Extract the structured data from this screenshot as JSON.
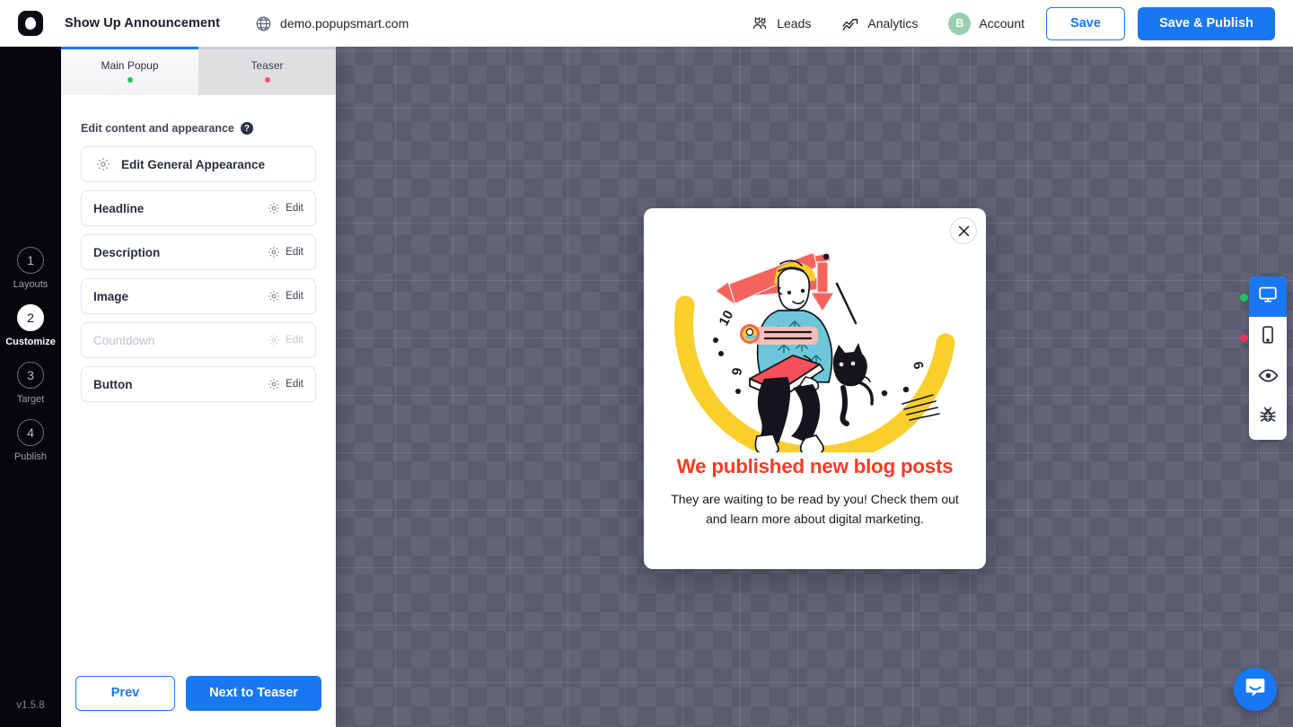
{
  "topbar": {
    "logo_icon": "popupsmart-logo-icon",
    "project_title": "Show Up Announcement",
    "site": {
      "globe_icon": "globe-icon",
      "url": "demo.popupsmart.com"
    },
    "links": [
      {
        "icon": "leads-people-icon",
        "label": "Leads"
      },
      {
        "icon": "analytics-chart-icon",
        "label": "Analytics"
      }
    ],
    "account": {
      "avatar_initial": "B",
      "avatar_color": "#97cfb0",
      "label": "Account"
    },
    "save_label": "Save",
    "publish_label": "Save & Publish",
    "accent_color": "#1877f2"
  },
  "rail": {
    "steps": [
      {
        "number": "1",
        "label": "Layouts",
        "active": false
      },
      {
        "number": "2",
        "label": "Customize",
        "active": true
      },
      {
        "number": "3",
        "label": "Target",
        "active": false
      },
      {
        "number": "4",
        "label": "Publish",
        "active": false
      }
    ],
    "version": "v1.5.8"
  },
  "panel": {
    "tabs": [
      {
        "label": "Main Popup",
        "active": true,
        "status_color": "#21c45d"
      },
      {
        "label": "Teaser",
        "active": false,
        "status_color": "#fa5a5a"
      }
    ],
    "section_title": "Edit content and appearance",
    "help_icon": "question-mark-icon",
    "primary_row": {
      "icon": "gear-icon",
      "label": "Edit General Appearance"
    },
    "rows": [
      {
        "label": "Headline",
        "edit_label": "Edit",
        "icon": "gear-icon",
        "disabled": false
      },
      {
        "label": "Description",
        "edit_label": "Edit",
        "icon": "gear-icon",
        "disabled": false
      },
      {
        "label": "Image",
        "edit_label": "Edit",
        "icon": "gear-icon",
        "disabled": false
      },
      {
        "label": "Countdown",
        "edit_label": "Edit",
        "icon": "gear-icon",
        "disabled": true
      },
      {
        "label": "Button",
        "edit_label": "Edit",
        "icon": "gear-icon",
        "disabled": false
      }
    ],
    "footer": {
      "prev_label": "Prev",
      "next_label": "Next to Teaser"
    }
  },
  "popup": {
    "close_icon": "close-x-icon",
    "illustration": "person-sitting-on-clock-with-cat-and-laptop-illustration",
    "headline": "We published new blog posts",
    "headline_color": "#fa3b21",
    "description": "They are waiting to be read by you! Check them out and learn more about digital marketing.",
    "cta": {
      "icon": "arrow-right-icon",
      "color": "#f50d4a"
    }
  },
  "devicebar": {
    "buttons": [
      {
        "icon": "desktop-monitor-icon",
        "name": "desktop",
        "active": true,
        "dot_color": "#21c45d"
      },
      {
        "icon": "mobile-phone-icon",
        "name": "mobile",
        "active": false,
        "dot_color": "#f0315c"
      },
      {
        "icon": "eye-preview-icon",
        "name": "preview",
        "active": false,
        "dot_color": ""
      },
      {
        "icon": "bug-debug-icon",
        "name": "debug",
        "active": false,
        "dot_color": ""
      }
    ]
  },
  "intercom": {
    "icon": "intercom-messenger-icon"
  }
}
